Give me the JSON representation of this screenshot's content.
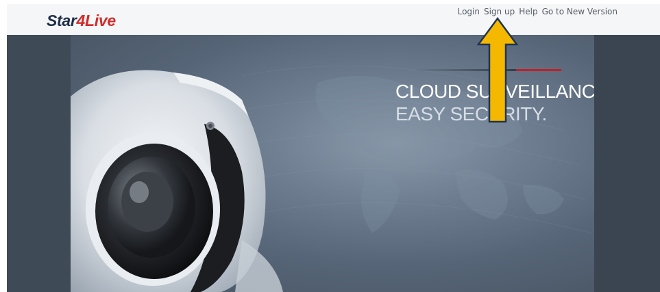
{
  "header": {
    "logo": {
      "part1": "Star",
      "part2": "4",
      "part3": "Live"
    },
    "nav": [
      {
        "label": "Login",
        "name": "login-link"
      },
      {
        "label": "Sign up",
        "name": "signup-link"
      },
      {
        "label": "Help",
        "name": "help-link"
      },
      {
        "label": "Go to New Version",
        "name": "new-version-link"
      }
    ]
  },
  "hero": {
    "line1": "CLOUD SURVEILLANCE,",
    "line2": "EASY SECURITY.",
    "image": "security-camera",
    "accent_color": "#c0202a"
  },
  "annotation": {
    "icon": "up-arrow-icon",
    "color": "#f5b800"
  }
}
